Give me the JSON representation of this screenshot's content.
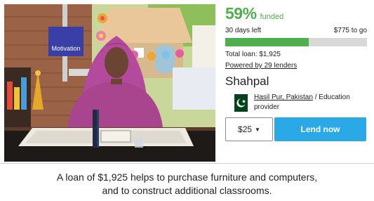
{
  "loan": {
    "funded_percent": "59%",
    "funded_label": "funded",
    "progress_fraction": 0.59,
    "days_left": "30 days left",
    "to_go": "$775 to go",
    "total_loan": "Total loan: $1,925",
    "lenders_link": "Powered by 29 lenders"
  },
  "borrower": {
    "name": "Shahpal",
    "location": "Hasil Pur, Pakistan",
    "separator": " / ",
    "sector": "Education provider",
    "flag_icon": "pakistan-flag-icon"
  },
  "actions": {
    "amount": "$25",
    "lend_label": "Lend now"
  },
  "photo": {
    "poster_text": "Motivation"
  },
  "description": {
    "line1": "A loan of $1,925 helps to purchase furniture and computers,",
    "line2": "and to construct additional classrooms."
  },
  "colors": {
    "funded_green": "#4faf4e",
    "lend_blue": "#2aa9e6",
    "progress_track": "#d8d8d8"
  }
}
